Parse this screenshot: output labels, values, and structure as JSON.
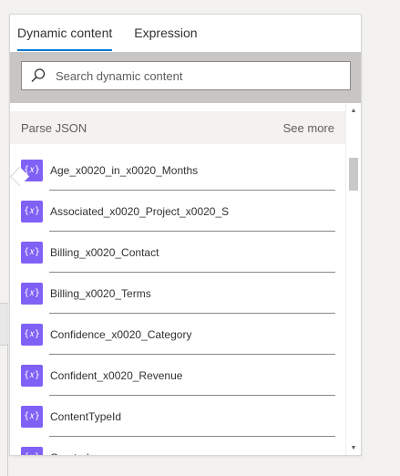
{
  "tabs": [
    {
      "label": "Dynamic content",
      "active": true
    },
    {
      "label": "Expression",
      "active": false
    }
  ],
  "search": {
    "placeholder": "Search dynamic content"
  },
  "section": {
    "title": "Parse JSON",
    "see_more": "See more"
  },
  "items": [
    {
      "label": "Age_x0020_in_x0020_Months",
      "icon": "expression-icon"
    },
    {
      "label": "Associated_x0020_Project_x0020_S",
      "icon": "expression-icon"
    },
    {
      "label": "Billing_x0020_Contact",
      "icon": "expression-icon"
    },
    {
      "label": "Billing_x0020_Terms",
      "icon": "expression-icon"
    },
    {
      "label": "Confidence_x0020_Category",
      "icon": "expression-icon"
    },
    {
      "label": "Confident_x0020_Revenue",
      "icon": "expression-icon"
    },
    {
      "label": "ContentTypeId",
      "icon": "expression-icon"
    },
    {
      "label": "Created",
      "icon": "expression-icon"
    }
  ],
  "icon_glyph": "{𝑥}",
  "colors": {
    "accent": "#0078d4",
    "icon_bg": "#8061f5",
    "search_band": "#c8c6c4"
  }
}
